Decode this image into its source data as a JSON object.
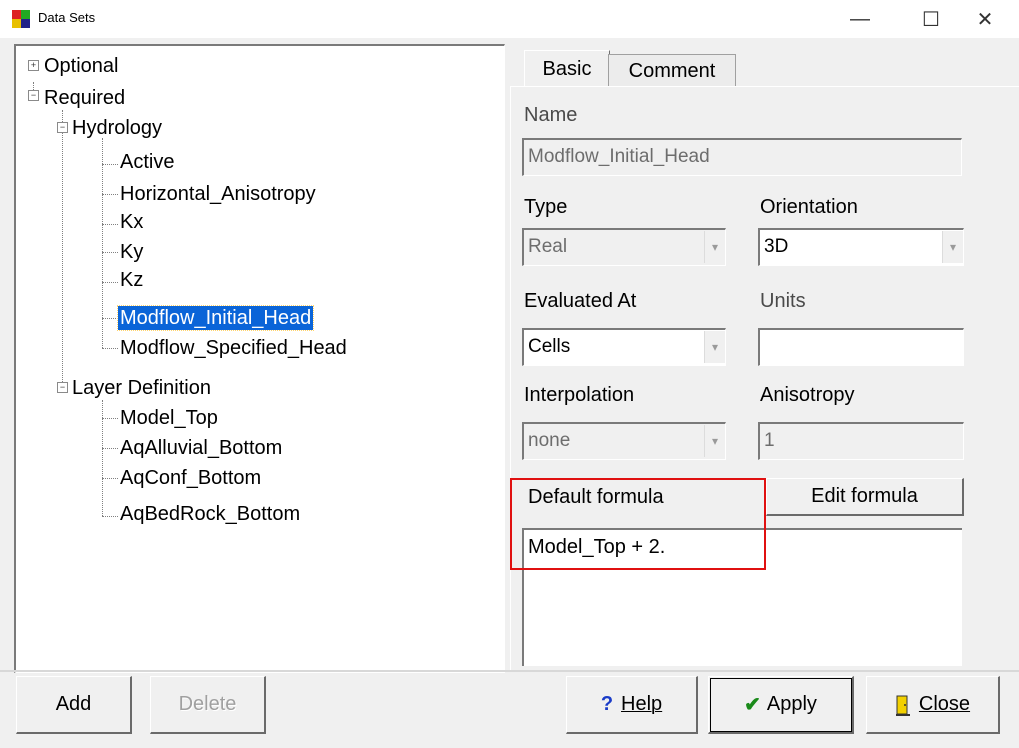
{
  "window": {
    "title": "Data Sets",
    "minimize": "—",
    "maximize": "☐",
    "close": "✕"
  },
  "tree": {
    "nodes": [
      {
        "label": "Optional",
        "toggle": "+"
      },
      {
        "label": "Required",
        "toggle": "−"
      },
      {
        "label": "Hydrology",
        "toggle": "−"
      },
      {
        "label": "Active"
      },
      {
        "label": "Horizontal_Anisotropy"
      },
      {
        "label": "Kx"
      },
      {
        "label": "Ky"
      },
      {
        "label": "Kz"
      },
      {
        "label": "Modflow_Initial_Head",
        "selected": true
      },
      {
        "label": "Modflow_Specified_Head"
      },
      {
        "label": "Layer Definition",
        "toggle": "−"
      },
      {
        "label": "Model_Top"
      },
      {
        "label": "AqAlluvial_Bottom"
      },
      {
        "label": "AqConf_Bottom"
      },
      {
        "label": "AqBedRock_Bottom"
      }
    ]
  },
  "tabs": {
    "basic": "Basic",
    "comment": "Comment"
  },
  "form": {
    "name_label": "Name",
    "name_value": "Modflow_Initial_Head",
    "type_label": "Type",
    "type_value": "Real",
    "orientation_label": "Orientation",
    "orientation_value": "3D",
    "evaluated_at_label": "Evaluated At",
    "evaluated_at_value": "Cells",
    "units_label": "Units",
    "units_value": "",
    "interpolation_label": "Interpolation",
    "interpolation_value": "none",
    "anisotropy_label": "Anisotropy",
    "anisotropy_value": "1",
    "default_formula_label": "Default formula",
    "edit_formula_button": "Edit formula",
    "formula_value": "Model_Top + 2."
  },
  "buttons": {
    "add": "Add",
    "delete": "Delete",
    "help": "Help",
    "apply": "Apply",
    "close": "Close"
  },
  "colors": {
    "selection": "#0a64d8",
    "highlight_box": "#e01010",
    "apply_check": "#1a8a1a",
    "help_mark": "#1a3cc8"
  }
}
